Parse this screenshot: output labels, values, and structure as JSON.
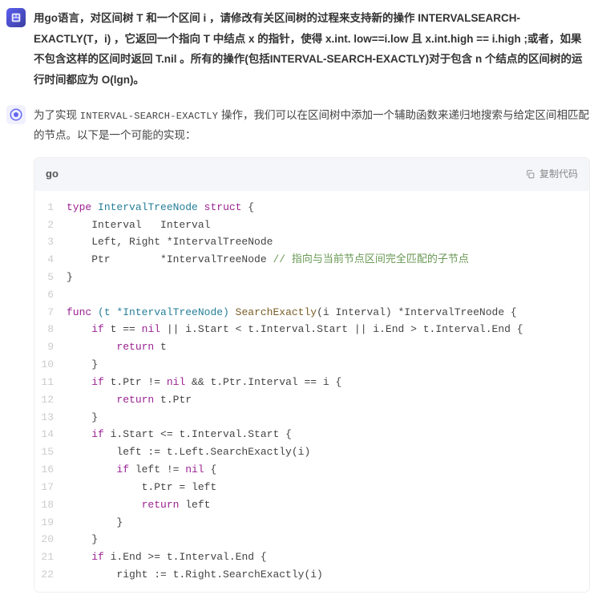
{
  "user_message": "用go语言，对区间树 T 和一个区间 i ，请修改有关区间树的过程来支持新的操作 INTERVALSEARCH-EXACTLY(T，i) ，它返回一个指向 T 中结点 x 的指针，使得 x.int. low==i.low 且 x.int.high == i.high ;或者，如果不包含这样的区间时返回 T.nil 。所有的操作(包括INTERVAL-SEARCH-EXACTLY)对于包含 n 个结点的区间树的运行时间都应为 O(lgn)。",
  "ai_intro_prefix": "为了实现 ",
  "ai_intro_code": "INTERVAL-SEARCH-EXACTLY",
  "ai_intro_suffix": " 操作，我们可以在区间树中添加一个辅助函数来递归地搜索与给定区间相匹配的节点。以下是一个可能的实现：",
  "code_lang": "go",
  "copy_label": "复制代码",
  "chart_data": null,
  "code": {
    "lines": [
      {
        "n": 1,
        "tokens": [
          [
            "kw",
            "type"
          ],
          [
            "pl",
            " "
          ],
          [
            "type",
            "IntervalTreeNode"
          ],
          [
            "pl",
            " "
          ],
          [
            "kw",
            "struct"
          ],
          [
            "pl",
            " {"
          ]
        ]
      },
      {
        "n": 2,
        "tokens": [
          [
            "pl",
            "    Interval   Interval"
          ]
        ]
      },
      {
        "n": 3,
        "tokens": [
          [
            "pl",
            "    Left, Right *IntervalTreeNode"
          ]
        ]
      },
      {
        "n": 4,
        "tokens": [
          [
            "pl",
            "    Ptr        *IntervalTreeNode "
          ],
          [
            "comment",
            "// 指向与当前节点区间完全匹配的子节点"
          ]
        ]
      },
      {
        "n": 5,
        "tokens": [
          [
            "pl",
            "}"
          ]
        ]
      },
      {
        "n": 6,
        "tokens": [
          [
            "pl",
            ""
          ]
        ]
      },
      {
        "n": 7,
        "tokens": [
          [
            "kw",
            "func"
          ],
          [
            "pl",
            " "
          ],
          [
            "type",
            "(t *IntervalTreeNode)"
          ],
          [
            "pl",
            " "
          ],
          [
            "func",
            "SearchExactly"
          ],
          [
            "pl",
            "(i Interval) *IntervalTreeNode {"
          ]
        ]
      },
      {
        "n": 8,
        "tokens": [
          [
            "pl",
            "    "
          ],
          [
            "kw",
            "if"
          ],
          [
            "pl",
            " t == "
          ],
          [
            "kw",
            "nil"
          ],
          [
            "pl",
            " || i.Start < t.Interval.Start || i.End > t.Interval.End {"
          ]
        ]
      },
      {
        "n": 9,
        "tokens": [
          [
            "pl",
            "        "
          ],
          [
            "kw",
            "return"
          ],
          [
            "pl",
            " t"
          ]
        ]
      },
      {
        "n": 10,
        "tokens": [
          [
            "pl",
            "    }"
          ]
        ]
      },
      {
        "n": 11,
        "tokens": [
          [
            "pl",
            "    "
          ],
          [
            "kw",
            "if"
          ],
          [
            "pl",
            " t.Ptr != "
          ],
          [
            "kw",
            "nil"
          ],
          [
            "pl",
            " && t.Ptr.Interval == i {"
          ]
        ]
      },
      {
        "n": 12,
        "tokens": [
          [
            "pl",
            "        "
          ],
          [
            "kw",
            "return"
          ],
          [
            "pl",
            " t.Ptr"
          ]
        ]
      },
      {
        "n": 13,
        "tokens": [
          [
            "pl",
            "    }"
          ]
        ]
      },
      {
        "n": 14,
        "tokens": [
          [
            "pl",
            "    "
          ],
          [
            "kw",
            "if"
          ],
          [
            "pl",
            " i.Start <= t.Interval.Start {"
          ]
        ]
      },
      {
        "n": 15,
        "tokens": [
          [
            "pl",
            "        left := t.Left.SearchExactly(i)"
          ]
        ]
      },
      {
        "n": 16,
        "tokens": [
          [
            "pl",
            "        "
          ],
          [
            "kw",
            "if"
          ],
          [
            "pl",
            " left != "
          ],
          [
            "kw",
            "nil"
          ],
          [
            "pl",
            " {"
          ]
        ]
      },
      {
        "n": 17,
        "tokens": [
          [
            "pl",
            "            t.Ptr = left"
          ]
        ]
      },
      {
        "n": 18,
        "tokens": [
          [
            "pl",
            "            "
          ],
          [
            "kw",
            "return"
          ],
          [
            "pl",
            " left"
          ]
        ]
      },
      {
        "n": 19,
        "tokens": [
          [
            "pl",
            "        }"
          ]
        ]
      },
      {
        "n": 20,
        "tokens": [
          [
            "pl",
            "    }"
          ]
        ]
      },
      {
        "n": 21,
        "tokens": [
          [
            "pl",
            "    "
          ],
          [
            "kw",
            "if"
          ],
          [
            "pl",
            " i.End >= t.Interval.End {"
          ]
        ]
      },
      {
        "n": 22,
        "tokens": [
          [
            "pl",
            "        right := t.Right.SearchExactly(i)"
          ]
        ]
      }
    ]
  }
}
